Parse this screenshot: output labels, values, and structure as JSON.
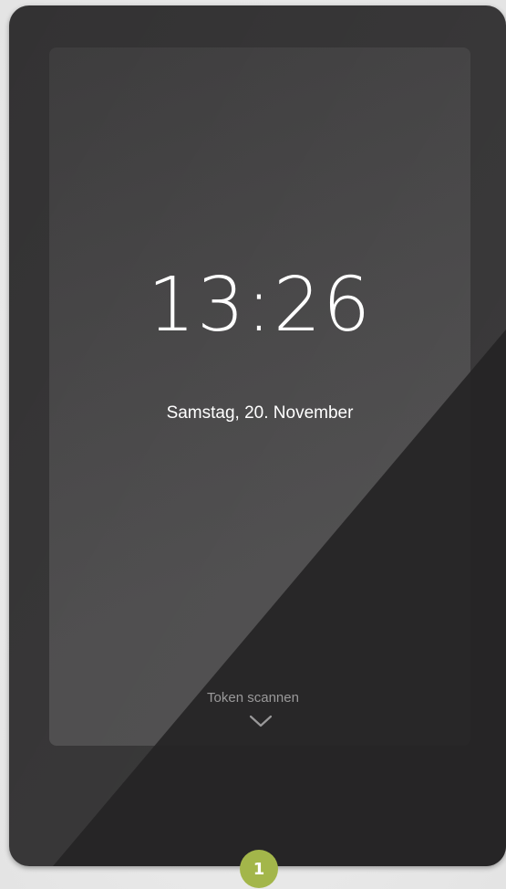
{
  "lock_screen": {
    "time": "13:26",
    "date": "Samstag, 20. November",
    "token_prompt": "Token scannen",
    "scroll_hint_icon": "chevron-down-icon"
  },
  "badge": {
    "number": "1",
    "color": "#a3b64a"
  },
  "colors": {
    "device_body": "#333233",
    "screen": "#474647",
    "text": "#ffffff",
    "muted_text": "#9a999a"
  }
}
